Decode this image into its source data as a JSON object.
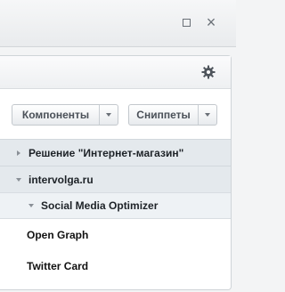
{
  "window": {
    "maximize_icon": "maximize-icon",
    "close_icon": "close-icon"
  },
  "panel": {
    "settings_icon": "gear-icon",
    "buttons": {
      "components_label": "Компоненты",
      "snippets_label": "Сниппеты"
    },
    "tree": [
      {
        "label": "Решение \"Интернет-магазин\"",
        "state": "collapsed",
        "level": 1
      },
      {
        "label": "intervolga.ru",
        "state": "expanded",
        "level": 1
      },
      {
        "label": "Social Media Optimizer",
        "state": "expanded",
        "level": 2
      }
    ],
    "items": [
      {
        "label": "Open Graph"
      },
      {
        "label": "Twitter Card"
      }
    ]
  },
  "colors": {
    "background": "#f3f4f5",
    "panel": "#ffffff",
    "group_row": "#e4e9ed",
    "subgroup_row": "#eef2f5",
    "button_text": "#4a5058"
  }
}
